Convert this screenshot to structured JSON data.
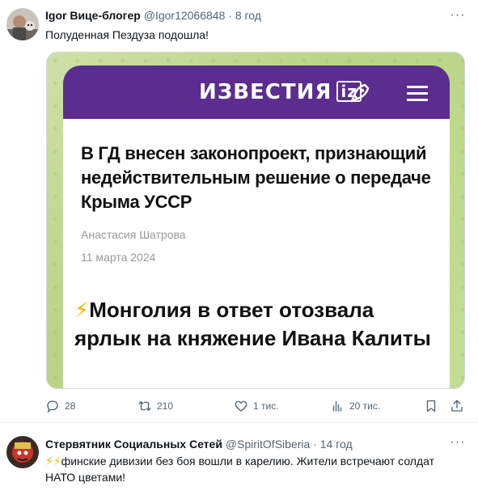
{
  "tweet1": {
    "name": "Igor Вице-блогер",
    "handle": "@Igor12066848",
    "separator": "·",
    "time": "8 год",
    "text": "Полуденная Пездуза подошла!",
    "media": {
      "logo": "ИЗВЕСТИЯ",
      "logo_box": "iz",
      "headline": "В ГД внесен законопроект, признающий недействительным решение о передаче Крыма УССР",
      "author": "Анастасия Шатрова",
      "date": "11 марта 2024",
      "bolt": "⚡",
      "headline2": "Монголия в ответ отозвала ярлык на княжение Ивана Калиты"
    },
    "actions": {
      "replies": "28",
      "retweets": "210",
      "likes": "1 тис.",
      "views": "20 тис."
    }
  },
  "tweet2": {
    "name": "Стервятник Социальных Сетей",
    "handle": "@SpiritOfSiberia",
    "separator": "·",
    "time": "14 год",
    "bolts": "⚡⚡",
    "text": "финские дивизии без боя вошли в карелию. Жители встречают солдат НАТО цветами!"
  },
  "colors": {
    "izvestia_purple": "#5a2d8f",
    "secondary_text": "#536471",
    "bolt": "#f2b705"
  }
}
